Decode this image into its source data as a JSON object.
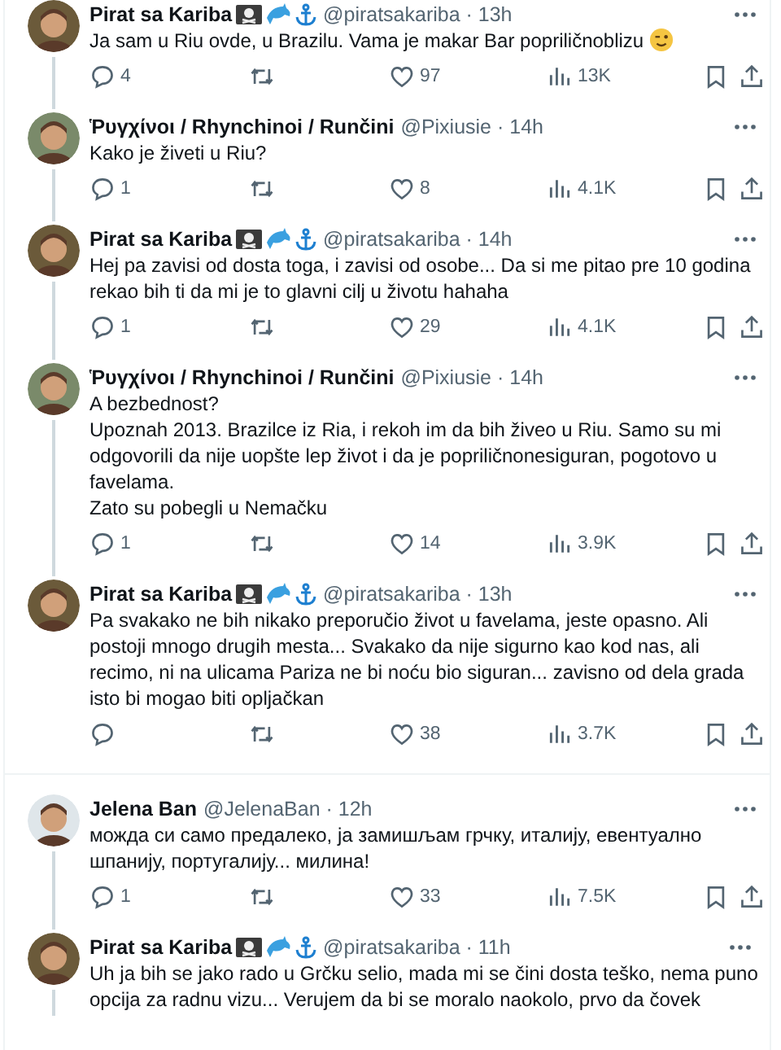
{
  "tweets": [
    {
      "avatar": {
        "color": "#6b5a3a"
      },
      "name": "Pirat sa Kariba",
      "badges": [
        {
          "kind": "flag"
        },
        {
          "kind": "dolphin"
        },
        {
          "kind": "anchor"
        }
      ],
      "handle": "@piratsakariba · 13h",
      "text": "Ja sam u Riu ovde, u Brazilu. Vama je makar Bar popriličnoblizu",
      "emojis": [
        {
          "kind": "wink"
        }
      ],
      "replies": "4",
      "likes": "97",
      "views": "13K",
      "divider_before": false,
      "thread_down": true
    },
    {
      "avatar": {
        "color": "#7a8a6a"
      },
      "name": "Ῥυγχίνοι / Rhynchinoi / Runčini",
      "handle": "@Pixiusie · 14h",
      "text": "Kako je živeti u Riu?",
      "replies": "1",
      "likes": "8",
      "views": "4.1K",
      "divider_before": false,
      "thread_down": true
    },
    {
      "avatar": {
        "color": "#6b5a3a"
      },
      "name": "Pirat sa Kariba",
      "badges": [
        {
          "kind": "flag"
        },
        {
          "kind": "dolphin"
        },
        {
          "kind": "anchor"
        }
      ],
      "handle": "@piratsakariba · 14h",
      "text": "Hej pa zavisi od dosta toga, i zavisi od osobe... Da si me pitao pre 10 godina rekao bih ti da mi je to glavni cilj u životu hahaha",
      "replies": "1",
      "likes": "29",
      "views": "4.1K",
      "divider_before": false,
      "thread_down": true
    },
    {
      "avatar": {
        "color": "#7a8a6a"
      },
      "name": "Ῥυγχίνοι / Rhynchinoi / Runčini",
      "handle": "@Pixiusie · 14h",
      "text": "A bezbednost?\nUpoznah 2013. Brazilce iz Ria, i rekoh im da bih živeo u Riu. Samo su mi odgovorili da nije uopšte lep život i da je popriličnonesiguran, pogotovo u favelama.\nZato su pobegli u Nemačku",
      "replies": "1",
      "likes": "14",
      "views": "3.9K",
      "divider_before": false,
      "thread_down": true
    },
    {
      "avatar": {
        "color": "#6b5a3a"
      },
      "name": "Pirat sa Kariba",
      "badges": [
        {
          "kind": "flag"
        },
        {
          "kind": "dolphin"
        },
        {
          "kind": "anchor"
        }
      ],
      "handle": "@piratsakariba · 13h",
      "text": "Pa svakako ne bih nikako preporučio život u favelama, jeste opasno. Ali postoji mnogo drugih mesta... Svakako da nije sigurno kao kod nas, ali recimo, ni na ulicama Pariza ne bi noću bio siguran... zavisno od dela grada isto bi mogao biti opljačkan",
      "likes": "38",
      "views": "3.7K",
      "divider_before": false,
      "thread_down": false
    },
    {
      "avatar": {
        "color": "#dfe6ea"
      },
      "name": "Jelena Ban",
      "handle": "@JelenaBan · 12h",
      "text": "можда си само предалеко, ја замишљам грчку, италију, евентуално шпанију, португалију... милина!",
      "replies": "1",
      "likes": "33",
      "views": "7.5K",
      "divider_before": true,
      "thread_down": true
    },
    {
      "avatar": {
        "color": "#6b5a3a"
      },
      "name": "Pirat sa Kariba",
      "badges": [
        {
          "kind": "flag"
        },
        {
          "kind": "dolphin"
        },
        {
          "kind": "anchor"
        }
      ],
      "handle": "@piratsakariba · 11h",
      "text": "Uh ja bih se jako rado u Grčku selio, mada mi se čini dosta teško, nema puno opcija za radnu vizu... Verujem da bi se moralo naokolo, prvo da čovek",
      "divider_before": false,
      "thread_down": true
    }
  ]
}
